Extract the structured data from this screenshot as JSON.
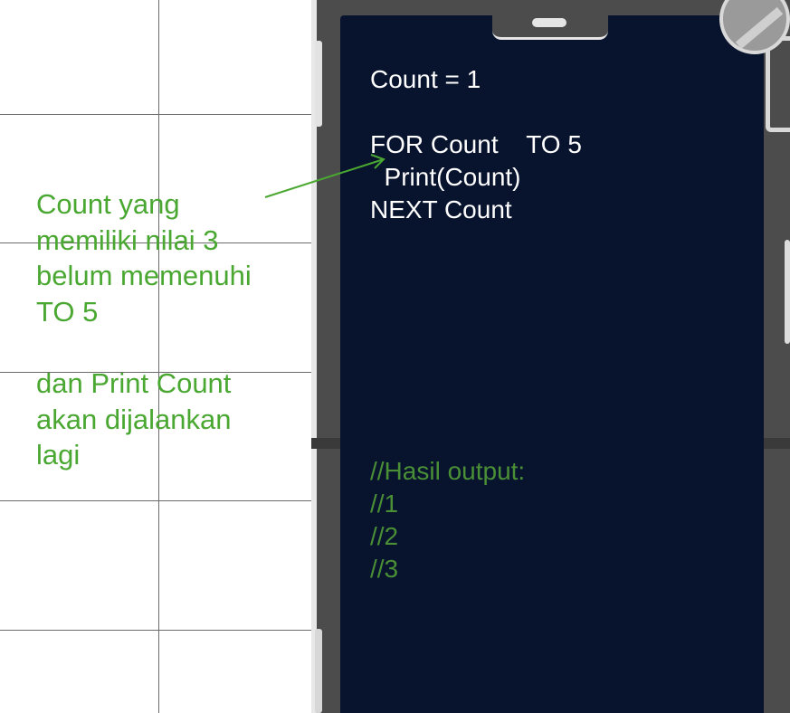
{
  "code": {
    "line1": "Count = 1",
    "line2": "FOR Count    TO 5",
    "line3": "  Print(Count)",
    "line4": "NEXT Count"
  },
  "output_comments": {
    "header": "//Hasil output:",
    "lines": [
      "//1",
      "//2",
      "//3"
    ]
  },
  "annotation": {
    "lines": [
      "Count yang",
      "memiliki nilai 3",
      "belum memenuhi",
      "TO 5",
      "",
      "dan Print Count",
      "akan dijalankan",
      "lagi"
    ]
  },
  "colors": {
    "phone_screen": "#08132e",
    "annotation_green": "#4aa832",
    "comment_green": "#4a8f36",
    "code_text": "#ffffff"
  }
}
